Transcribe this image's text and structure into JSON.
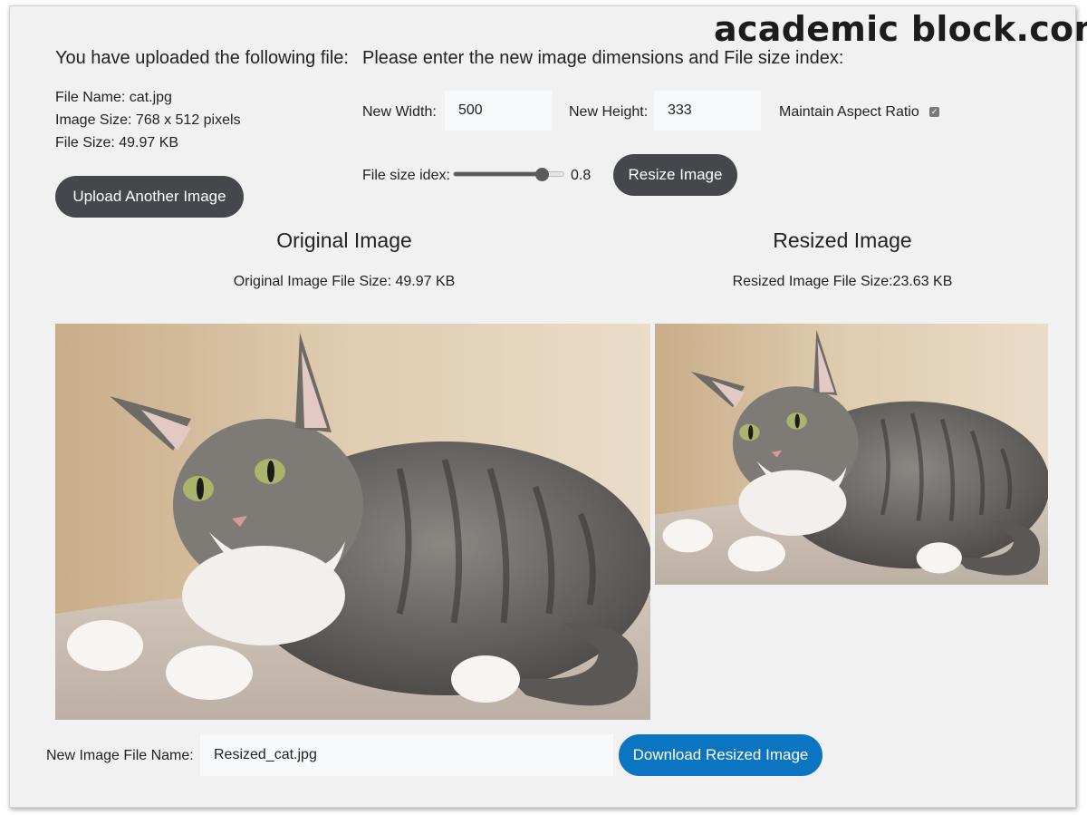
{
  "watermark": "academic block.com",
  "upload_info": {
    "heading": "You have uploaded the following file:",
    "file_name": "File Name: cat.jpg",
    "image_size": "Image Size: 768 x 512 pixels",
    "file_size": "File Size: 49.97 KB",
    "upload_button": "Upload Another Image"
  },
  "resize_form": {
    "heading": "Please enter the new image dimensions and File size index:",
    "width_label": "New Width:",
    "width_value": "500",
    "height_label": "New Height:",
    "height_value": "333",
    "aspect_label": "Maintain Aspect Ratio",
    "aspect_checked": true,
    "filesize_label": "File size idex:",
    "filesize_value": "0.8",
    "filesize_fraction": 0.8,
    "resize_button": "Resize Image"
  },
  "original": {
    "title": "Original Image",
    "size_text": "Original Image File Size: 49.97 KB"
  },
  "resized": {
    "title": "Resized Image",
    "size_text": "Resized Image File Size:23.63 KB"
  },
  "download": {
    "filename_label": "New Image File Name:",
    "filename_value": "Resized_cat.jpg",
    "download_button": "Download Resized Image"
  },
  "colors": {
    "dark_button": "#45474c",
    "blue_button": "#0c75c2",
    "panel_background": "#f1f1f1"
  }
}
